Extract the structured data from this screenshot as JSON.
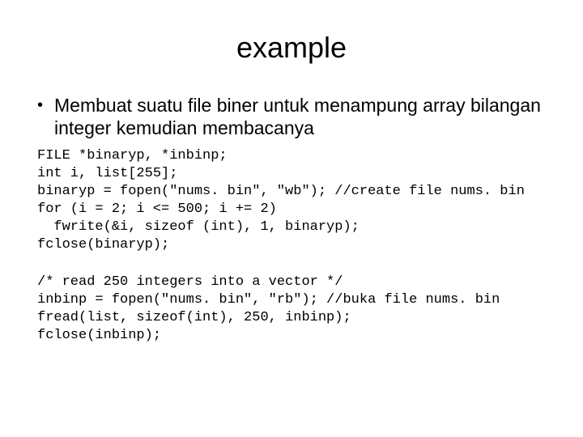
{
  "title": "example",
  "bullet": "Membuat suatu file biner untuk menampung array bilangan integer kemudian membacanya",
  "code_lines_1": [
    "FILE *binaryp, *inbinp;",
    "int i, list[255];",
    "binaryp = fopen(\"nums. bin\", \"wb\"); //create file nums. bin",
    "for (i = 2; i <= 500; i += 2)",
    "  fwrite(&i, sizeof (int), 1, binaryp);",
    "fclose(binaryp);"
  ],
  "code_lines_2": [
    "/* read 250 integers into a vector */",
    "inbinp = fopen(\"nums. bin\", \"rb\"); //buka file nums. bin",
    "fread(list, sizeof(int), 250, inbinp);",
    "fclose(inbinp);"
  ]
}
